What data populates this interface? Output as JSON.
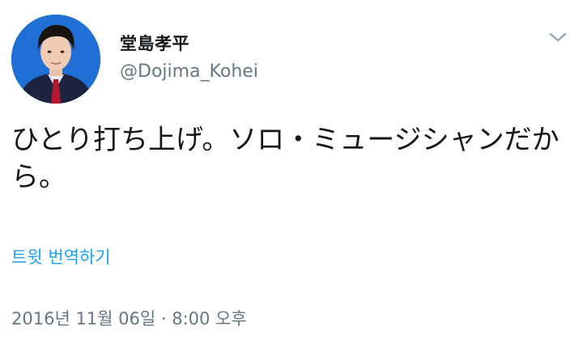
{
  "author": {
    "display_name": "堂島孝平",
    "handle": "@Dojima_Kohei",
    "avatar_icon": "profile-photo-icon"
  },
  "menu": {
    "icon": "chevron-down-icon"
  },
  "tweet": {
    "text": "ひとり打ち上げ。ソロ・ミュージシャンだから。",
    "translate_label": "트윗 번역하기",
    "timestamp": "2016년 11월 06일 · 8:00 오후"
  },
  "colors": {
    "link": "#1da1f2",
    "secondary_text": "#657786",
    "primary_text": "#14171a",
    "avatar_bg": "#1f6fd6"
  }
}
